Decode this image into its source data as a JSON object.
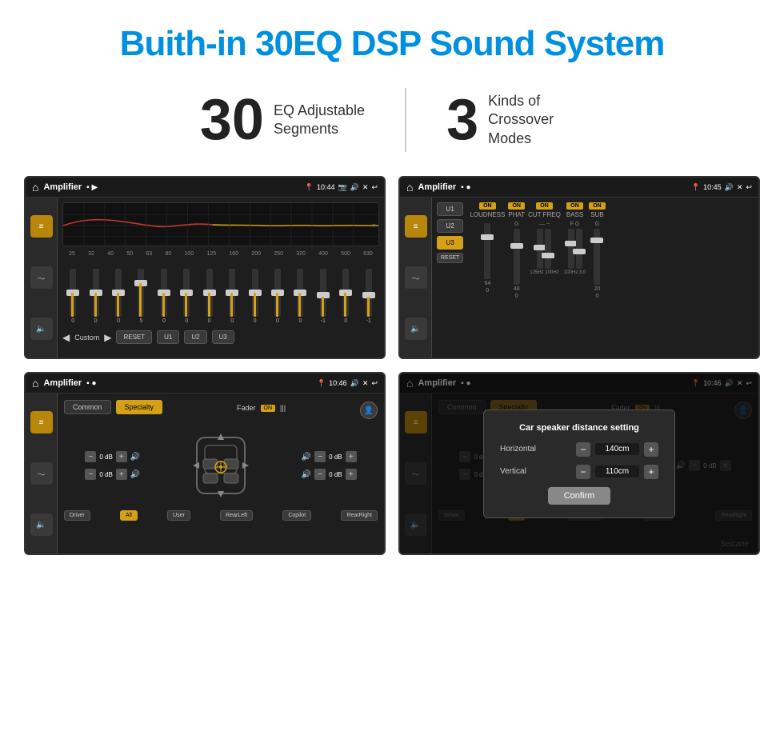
{
  "header": {
    "title": "Buith-in 30EQ DSP Sound System"
  },
  "stats": [
    {
      "number": "30",
      "desc_line1": "EQ Adjustable",
      "desc_line2": "Segments"
    },
    {
      "number": "3",
      "desc_line1": "Kinds of",
      "desc_line2": "Crossover Modes"
    }
  ],
  "screen1": {
    "time": "10:44",
    "app": "Amplifier",
    "freqs": [
      "25",
      "32",
      "40",
      "50",
      "63",
      "80",
      "100",
      "125",
      "160",
      "200",
      "250",
      "320",
      "400",
      "500",
      "630"
    ],
    "values": [
      "0",
      "0",
      "0",
      "5",
      "0",
      "0",
      "0",
      "0",
      "0",
      "0",
      "0",
      "-1",
      "0",
      "-1",
      ""
    ],
    "mode": "Custom",
    "buttons": [
      "RESET",
      "U1",
      "U2",
      "U3"
    ]
  },
  "screen2": {
    "time": "10:45",
    "app": "Amplifier",
    "presets": [
      "U1",
      "U2",
      "U3"
    ],
    "activePreset": "U3",
    "channels": [
      "LOUDNESS",
      "PHAT",
      "CUT FREQ",
      "BASS",
      "SUB"
    ],
    "reset": "RESET"
  },
  "screen3": {
    "time": "10:46",
    "app": "Amplifier",
    "tabs": [
      "Common",
      "Specialty"
    ],
    "activeTab": "Specialty",
    "fader": "Fader",
    "faderOn": "ON",
    "dbValues": [
      "0 dB",
      "0 dB",
      "0 dB",
      "0 dB"
    ],
    "zones": [
      "Driver",
      "RearLeft",
      "All",
      "User",
      "Copilot",
      "RearRight"
    ]
  },
  "screen4": {
    "time": "10:46",
    "app": "Amplifier",
    "tabs": [
      "Common",
      "Specialty"
    ],
    "activeTab": "Specialty",
    "dialog": {
      "title": "Car speaker distance setting",
      "horizontal_label": "Horizontal",
      "horizontal_value": "140cm",
      "vertical_label": "Vertical",
      "vertical_value": "110cm",
      "confirm_btn": "Confirm"
    },
    "dbValues": [
      "0 dB",
      "0 dB"
    ],
    "zones": [
      "Driver",
      "RearLeft",
      "All",
      "RearRight",
      "Copilot"
    ]
  },
  "watermark": "Seicane"
}
